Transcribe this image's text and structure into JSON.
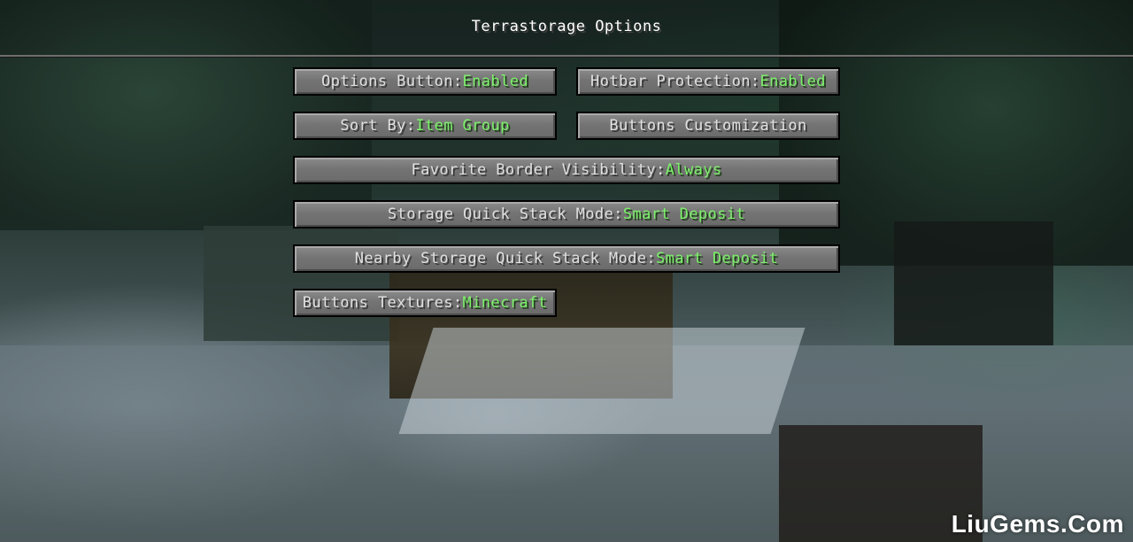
{
  "screen": {
    "title": "Terrastorage Options"
  },
  "colors": {
    "value_green": "#7cf06a",
    "button_text": "#e0e0e0"
  },
  "buttons": [
    {
      "label": "Options Button: ",
      "value": "Enabled"
    },
    {
      "label": "Hotbar Protection: ",
      "value": "Enabled"
    },
    {
      "label": "Sort By: ",
      "value": "Item Group"
    },
    {
      "label": "Buttons Customization",
      "value": ""
    },
    {
      "label": "Favorite Border Visibility: ",
      "value": "Always"
    },
    {
      "label": "Storage Quick Stack Mode: ",
      "value": "Smart Deposit"
    },
    {
      "label": "Nearby Storage Quick Stack Mode: ",
      "value": "Smart Deposit"
    },
    {
      "label": "Buttons Textures: ",
      "value": "Minecraft"
    }
  ],
  "watermark": "LiuGems.Com"
}
